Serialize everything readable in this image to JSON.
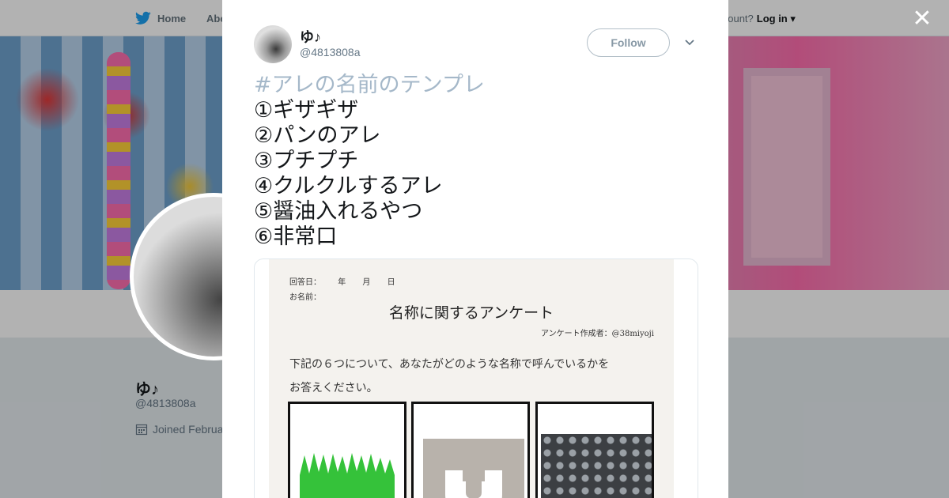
{
  "background_page": {
    "nav": {
      "home_label": "Home",
      "about_label": "Abo",
      "account_prefix": "account?",
      "login_label": "Log in"
    },
    "profile": {
      "name": "ゆ♪",
      "handle": "@4813808a",
      "joined": "Joined Februa"
    }
  },
  "modal": {
    "author": {
      "name": "ゆ♪",
      "handle": "@4813808a"
    },
    "follow_label": "Follow",
    "tweet": {
      "hashtag": "#アレの名前のテンプレ",
      "lines": [
        "①ギザギザ",
        "②パンのアレ",
        "③プチプチ",
        "④クルクルするアレ",
        "⑤醤油入れるやつ",
        "⑥非常口"
      ]
    },
    "media": {
      "answer_date_label": "回答日：",
      "date_year": "年",
      "date_month": "月",
      "date_day": "日",
      "name_label": "お名前：",
      "title": "名称に関するアンケート",
      "author_credit": "アンケート作成者：@38miyoji",
      "body_line1": "下記の６つについて、あなたがどのような名称で呼んでいるかを",
      "body_line2": "お答えください。"
    }
  },
  "colors": {
    "twitter_blue": "#1da1f2",
    "hashtag": "#a5b8c9",
    "text_primary": "#14171a",
    "text_secondary": "#657786"
  },
  "icons": {
    "nav_home": "twitter-bird-icon",
    "close": "close-icon",
    "caret": "chevron-down-icon",
    "calendar": "calendar-icon"
  }
}
